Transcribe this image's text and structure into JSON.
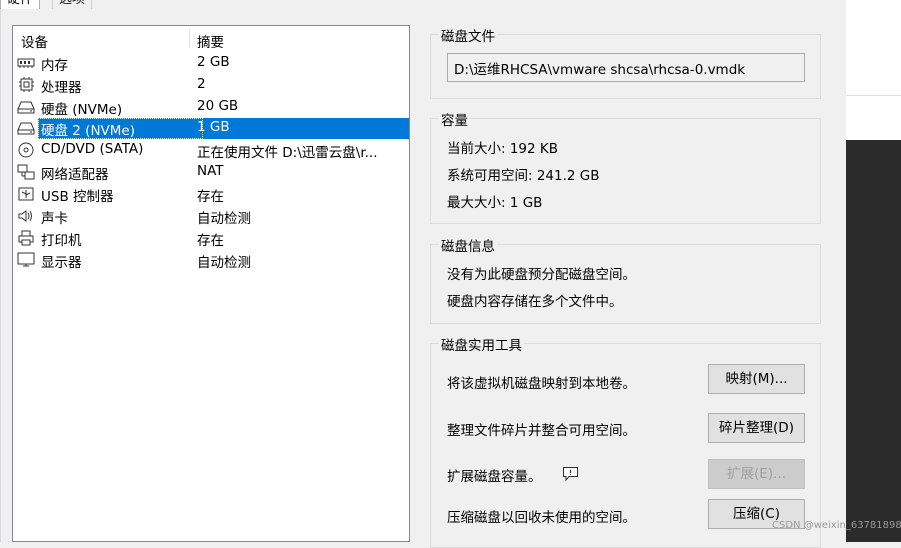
{
  "tabs": {
    "hardware": "硬件",
    "options": "选项"
  },
  "device_list": {
    "header_device": "设备",
    "header_summary": "摘要",
    "items": [
      {
        "icon": "memory-icon",
        "name": "内存",
        "summary": "2 GB"
      },
      {
        "icon": "cpu-icon",
        "name": "处理器",
        "summary": "2"
      },
      {
        "icon": "disk-icon",
        "name": "硬盘 (NVMe)",
        "summary": "20 GB"
      },
      {
        "icon": "disk-icon",
        "name": "硬盘 2 (NVMe)",
        "summary": "1 GB",
        "selected": true
      },
      {
        "icon": "cd-icon",
        "name": "CD/DVD (SATA)",
        "summary": "正在使用文件 D:\\迅雷云盘\\r..."
      },
      {
        "icon": "network-icon",
        "name": "网络适配器",
        "summary": "NAT"
      },
      {
        "icon": "usb-icon",
        "name": "USB 控制器",
        "summary": "存在"
      },
      {
        "icon": "speaker-icon",
        "name": "声卡",
        "summary": "自动检测"
      },
      {
        "icon": "printer-icon",
        "name": "打印机",
        "summary": "存在"
      },
      {
        "icon": "monitor-icon",
        "name": "显示器",
        "summary": "自动检测"
      }
    ]
  },
  "disk_file": {
    "title": "磁盘文件",
    "path": "D:\\运维RHCSA\\vmware shcsa\\rhcsa-0.vmdk"
  },
  "capacity": {
    "title": "容量",
    "current": "当前大小: 192 KB",
    "available": "系统可用空间: 241.2 GB",
    "max": "最大大小: 1 GB"
  },
  "disk_info": {
    "title": "磁盘信息",
    "line1": "没有为此硬盘预分配磁盘空间。",
    "line2": "硬盘内容存储在多个文件中。"
  },
  "utilities": {
    "title": "磁盘实用工具",
    "map_text": "将该虚拟机磁盘映射到本地卷。",
    "map_button": "映射(M)...",
    "defrag_text": "整理文件碎片并整合可用空间。",
    "defrag_button": "碎片整理(D)",
    "expand_text": "扩展磁盘容量。",
    "expand_button": "扩展(E)...",
    "compact_text": "压缩磁盘以回收未使用的空间。",
    "compact_button": "压缩(C)"
  },
  "watermark": "CSDN @weixin_63781898"
}
